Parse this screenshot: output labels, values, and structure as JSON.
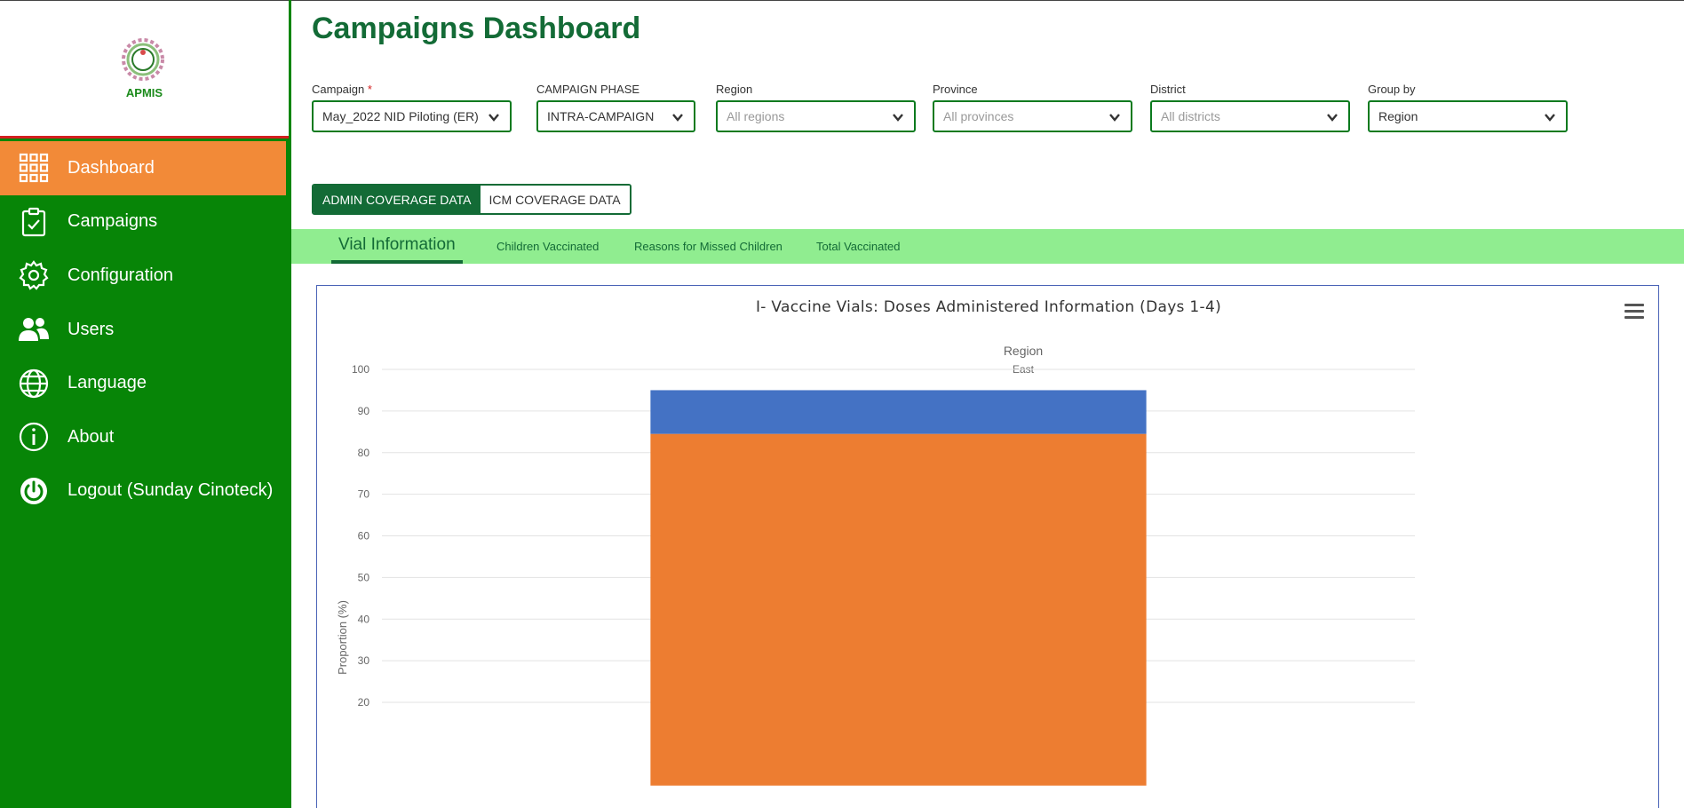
{
  "app": {
    "logo_text": "APMIS"
  },
  "sidebar": {
    "items": [
      {
        "label": "Dashboard",
        "icon": "grid-icon",
        "active": true
      },
      {
        "label": "Campaigns",
        "icon": "clipboard-check-icon"
      },
      {
        "label": "Configuration",
        "icon": "gear-icon"
      },
      {
        "label": "Users",
        "icon": "users-icon"
      },
      {
        "label": "Language",
        "icon": "globe-icon"
      },
      {
        "label": "About",
        "icon": "info-icon"
      },
      {
        "label": "Logout (Sunday Cinoteck)",
        "icon": "power-icon"
      }
    ]
  },
  "main": {
    "title": "Campaigns Dashboard",
    "filters": {
      "campaign": {
        "label": "Campaign",
        "required": "*",
        "value": "May_2022 NID Piloting (ER)"
      },
      "phase": {
        "label": "CAMPAIGN PHASE",
        "value": "INTRA-CAMPAIGN"
      },
      "region": {
        "label": "Region",
        "placeholder": "All regions"
      },
      "province": {
        "label": "Province",
        "placeholder": "All provinces"
      },
      "district": {
        "label": "District",
        "placeholder": "All districts"
      },
      "groupby": {
        "label": "Group by",
        "value": "Region"
      }
    },
    "toggle": {
      "admin": "ADMIN COVERAGE DATA",
      "icm": "ICM COVERAGE DATA"
    },
    "tabs": [
      {
        "label": "Vial Information",
        "active": true
      },
      {
        "label": "Children Vaccinated"
      },
      {
        "label": "Reasons for Missed Children"
      },
      {
        "label": "Total Vaccinated"
      }
    ]
  },
  "colors": {
    "sidebar": "#078507",
    "active": "#f28a38",
    "brand": "#136b36",
    "tabbar": "#90ed90",
    "series_top": "#4472c4",
    "series_bottom": "#ed7d31"
  },
  "chart_data": {
    "type": "bar",
    "stacked": true,
    "title": "I- Vaccine Vials: Doses Administered Information (Days 1-4)",
    "xlabel": "Region",
    "ylabel": "Proportion (%)",
    "categories": [
      "East"
    ],
    "series": [
      {
        "values": [
          84.5
        ],
        "color": "#ed7d31"
      },
      {
        "values": [
          10.5
        ],
        "color": "#4472c4"
      }
    ],
    "yticks": [
      20,
      30,
      40,
      50,
      60,
      70,
      80,
      90,
      100
    ],
    "ylim": [
      0,
      100
    ],
    "grid": true
  }
}
